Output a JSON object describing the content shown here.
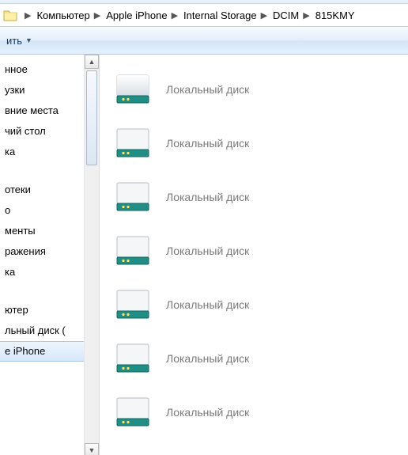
{
  "breadcrumb": {
    "items": [
      {
        "label": "Компьютер"
      },
      {
        "label": "Apple iPhone"
      },
      {
        "label": "Internal Storage"
      },
      {
        "label": "DCIM"
      },
      {
        "label": "815KMY"
      }
    ]
  },
  "toolbar": {
    "share_label": "ить"
  },
  "sidebar": {
    "group1": [
      "нное",
      "узки",
      "вние места",
      "чий стол",
      "ка"
    ],
    "group2": [
      "отеки",
      "о",
      "менты",
      "ражения",
      "ка"
    ],
    "group3": [
      "ютер",
      "льный диск (",
      "e iPhone"
    ],
    "selected_index_g3": 2
  },
  "content": {
    "items": [
      {
        "label": "Локальный диск"
      },
      {
        "label": "Локальный диск"
      },
      {
        "label": "Локальный диск"
      },
      {
        "label": "Локальный диск"
      },
      {
        "label": "Локальный диск"
      },
      {
        "label": "Локальный диск"
      },
      {
        "label": "Локальный диск"
      }
    ]
  }
}
